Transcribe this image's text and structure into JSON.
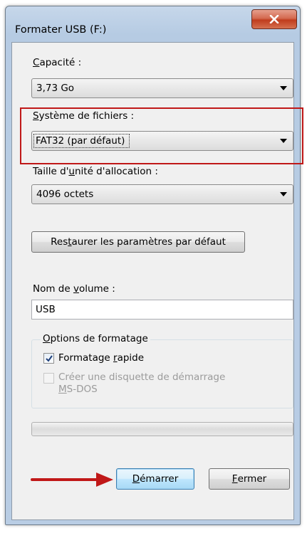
{
  "window": {
    "title": "Formater USB (F:)",
    "close_label": "x"
  },
  "capacity": {
    "label_pre": "",
    "label_accel": "C",
    "label_post": "apacité :",
    "value": "3,73 Go"
  },
  "filesystem": {
    "label_pre": "",
    "label_accel": "S",
    "label_post": "ystème de fichiers :",
    "value": "FAT32 (par défaut)"
  },
  "allocation": {
    "label_pre": "Taille d'",
    "label_accel": "u",
    "label_post": "nité d'allocation :",
    "value": "4096 octets"
  },
  "restore_button": {
    "label_pre": "Res",
    "label_accel": "t",
    "label_post": "aurer les paramètres par défaut"
  },
  "volume": {
    "label_pre": "Nom de ",
    "label_accel": "v",
    "label_post": "olume :",
    "value": "USB"
  },
  "format_options": {
    "title_pre": "",
    "title_accel": "O",
    "title_post": "ptions de formatage",
    "quick_format": {
      "label_pre": "Formatage ",
      "label_accel": "r",
      "label_post": "apide",
      "checked": true
    },
    "msdos_disk": {
      "label_line1": "Créer une disquette de démarrage",
      "label_accel": "M",
      "label_line2_post": "S-DOS",
      "checked": false,
      "enabled": false
    }
  },
  "progress": {
    "value": 0
  },
  "start_button": {
    "label_pre": "",
    "label_accel": "D",
    "label_post": "émarrer"
  },
  "close_button": {
    "label_pre": "",
    "label_accel": "F",
    "label_post": "ermer"
  },
  "colors": {
    "highlight": "#c01818",
    "arrow": "#c01818",
    "close_button": "#c03c1d"
  }
}
